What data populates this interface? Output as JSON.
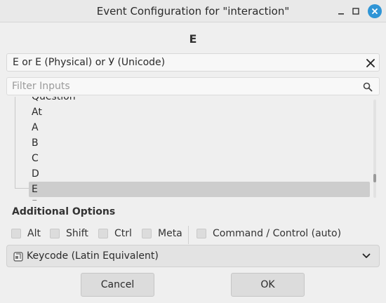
{
  "window": {
    "title": "Event Configuration for \"interaction\"",
    "minimize_icon": "minimize-icon",
    "maximize_icon": "maximize-icon",
    "close_icon": "close-icon",
    "close_color": "#2f95d6"
  },
  "event": {
    "key_heading": "E",
    "description": "E or E (Physical) or У (Unicode)",
    "clear_icon": "close-icon"
  },
  "filter": {
    "placeholder": "Filter Inputs",
    "value": "",
    "icon": "search-icon"
  },
  "tree": {
    "items": [
      {
        "label": "Question",
        "selected": false
      },
      {
        "label": "At",
        "selected": false
      },
      {
        "label": "A",
        "selected": false
      },
      {
        "label": "B",
        "selected": false
      },
      {
        "label": "C",
        "selected": false
      },
      {
        "label": "D",
        "selected": false
      },
      {
        "label": "E",
        "selected": true
      },
      {
        "label": "F",
        "selected": false
      }
    ]
  },
  "options": {
    "heading": "Additional Options",
    "modifiers": [
      {
        "label": "Alt",
        "checked": false
      },
      {
        "label": "Shift",
        "checked": false
      },
      {
        "label": "Ctrl",
        "checked": false
      },
      {
        "label": "Meta",
        "checked": false
      }
    ],
    "command_control": {
      "label": "Command / Control (auto)",
      "checked": false
    }
  },
  "keycode_select": {
    "selected": "Keycode (Latin Equivalent)",
    "icon": "keyboard-icon"
  },
  "buttons": {
    "cancel": "Cancel",
    "ok": "OK"
  }
}
